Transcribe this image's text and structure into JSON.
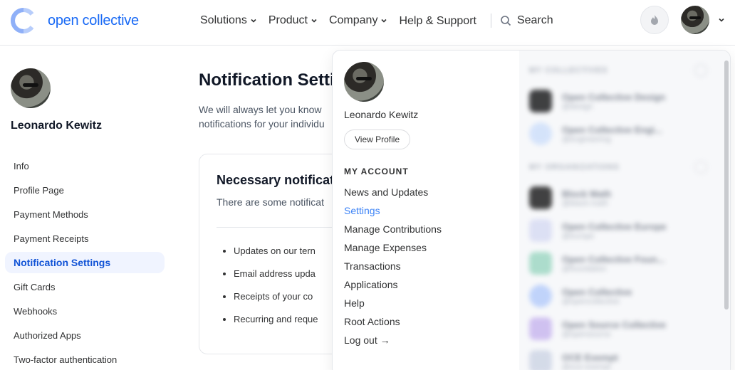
{
  "brand": {
    "name": "open collective",
    "color": "#1869f5"
  },
  "nav": {
    "items": [
      {
        "label": "Solutions"
      },
      {
        "label": "Product"
      },
      {
        "label": "Company"
      }
    ],
    "help_label": "Help & Support",
    "search_label": "Search"
  },
  "user": {
    "name": "Leonardo Kewitz"
  },
  "sidebar": {
    "items": [
      {
        "label": "Info"
      },
      {
        "label": "Profile Page"
      },
      {
        "label": "Payment Methods"
      },
      {
        "label": "Payment Receipts"
      },
      {
        "label": "Notification Settings",
        "active": true
      },
      {
        "label": "Gift Cards"
      },
      {
        "label": "Webhooks"
      },
      {
        "label": "Authorized Apps"
      },
      {
        "label": "Two-factor authentication"
      }
    ]
  },
  "main": {
    "title": "Notification Setti",
    "description": "We will always let you know",
    "description_line2": "notifications for your individu",
    "card": {
      "title": "Necessary notificat",
      "description": "There are some notificat",
      "list": [
        "Updates on our tern",
        "Email address upda",
        "Receipts of your co",
        "Recurring and reque"
      ]
    }
  },
  "dropdown": {
    "view_profile_label": "View Profile",
    "heading": "MY ACCOUNT",
    "items": [
      "News and Updates",
      "Settings",
      "Manage Contributions",
      "Manage Expenses",
      "Transactions",
      "Applications",
      "Help",
      "Root Actions",
      "Log out →"
    ],
    "active_item": "Settings",
    "collectives_heading": "MY COLLECTIVES",
    "collectives": [
      {
        "name": "Open Collective Design",
        "slug": "@design"
      },
      {
        "name": "Open Collective Engi...",
        "slug": "@engineering"
      }
    ],
    "organizations_heading": "MY ORGANIZATIONS",
    "organizations": [
      {
        "name": "Block Math",
        "slug": "@black-math"
      },
      {
        "name": "Open Collective Europe",
        "slug": "@europe"
      },
      {
        "name": "Open Collective Foun...",
        "slug": "@foundation"
      },
      {
        "name": "Open Collective",
        "slug": "@opencollective"
      },
      {
        "name": "Open Source Collective",
        "slug": "@opensource"
      },
      {
        "name": "OCE Exempt",
        "slug": "@oce-exempt"
      }
    ]
  },
  "colors": {
    "active_link": "#1153d6",
    "dropdown_active": "#3b82f6"
  }
}
